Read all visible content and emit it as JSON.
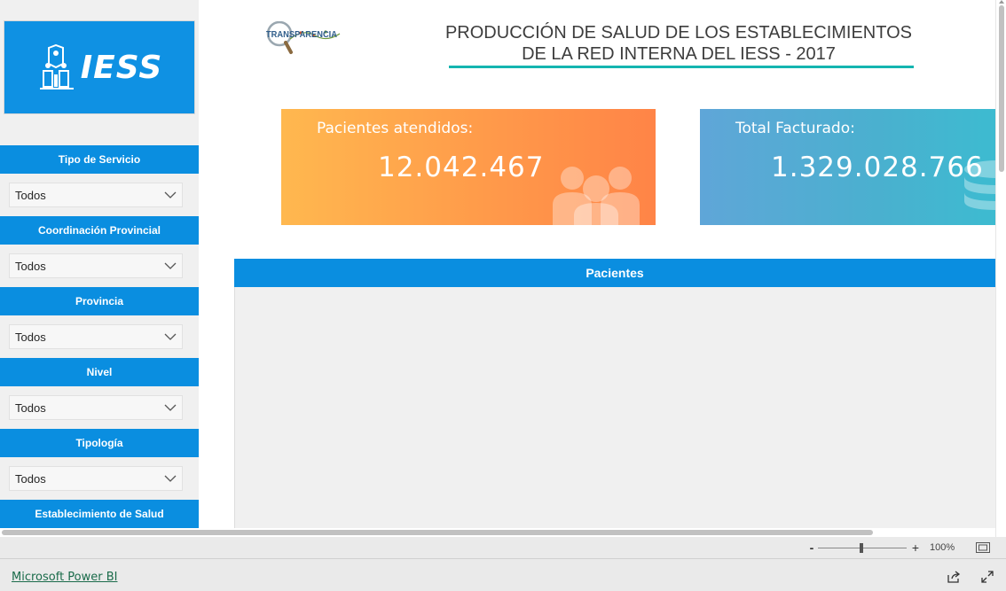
{
  "sidebar": {
    "logo_text": "IESS",
    "filters": [
      {
        "label": "Tipo de Servicio",
        "value": "Todos"
      },
      {
        "label": "Coordinación Provincial",
        "value": "Todos"
      },
      {
        "label": "Provincia",
        "value": "Todos"
      },
      {
        "label": "Nivel",
        "value": "Todos"
      },
      {
        "label": "Tipología",
        "value": "Todos"
      },
      {
        "label": "Establecimiento de Salud"
      }
    ]
  },
  "header": {
    "transparency_logo_text": "TRANSPARENCIA",
    "title_line1": "PRODUCCIÓN DE SALUD DE LOS ESTABLECIMIENTOS",
    "title_line2": "DE LA RED INTERNA DEL IESS - 2017",
    "accent_color": "#14b5b0"
  },
  "kpis": [
    {
      "label": "Pacientes atendidos:",
      "value": "12.042.467",
      "icon": "people-icon"
    },
    {
      "label": "Total Facturado:",
      "value": "1.329.028.766",
      "icon": "coins-icon"
    }
  ],
  "panel": {
    "title": "Pacientes"
  },
  "zoom": {
    "minus": "-",
    "plus": "+",
    "percent": "100%",
    "level": 1.0
  },
  "footer": {
    "link_text": "Microsoft Power BI"
  },
  "colors": {
    "brand_blue": "#0a8ee0",
    "kpi1_start": "#ffb84f",
    "kpi1_end": "#ff8447",
    "kpi2_start": "#5fa6d8",
    "kpi2_end": "#3dbbd0"
  }
}
